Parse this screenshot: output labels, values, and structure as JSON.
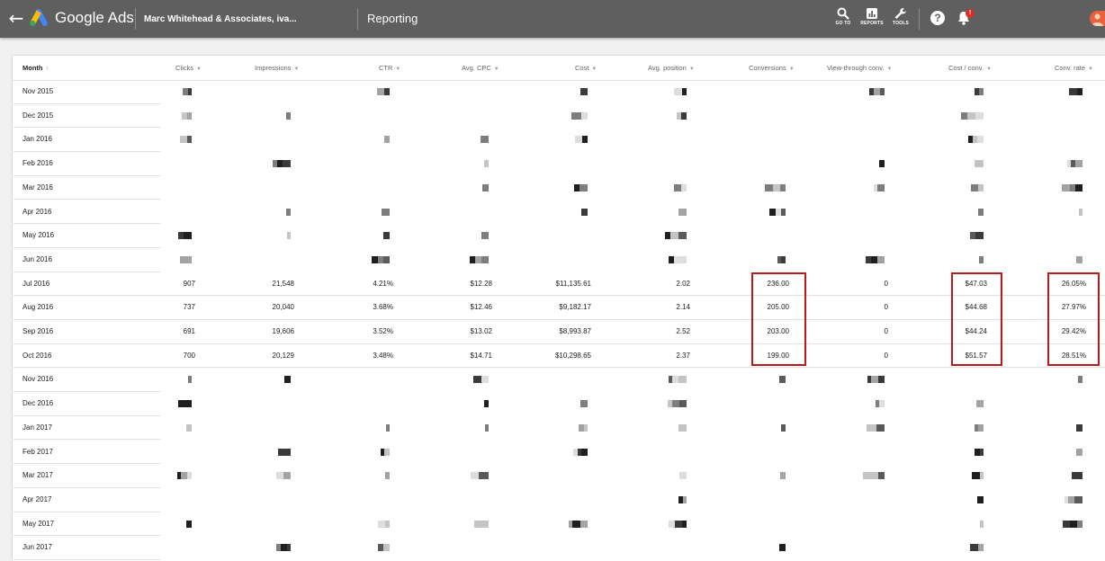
{
  "header": {
    "back_icon": "back-arrow-icon",
    "brand": "Google Ads",
    "account": "Marc Whitehead & Associates, iva...",
    "section": "Reporting",
    "tools": [
      {
        "label": "GO TO",
        "icon": "search-icon"
      },
      {
        "label": "REPORTS",
        "icon": "reports-icon"
      },
      {
        "label": "TOOLS",
        "icon": "wrench-icon"
      }
    ],
    "help_icon": "help-icon",
    "notifications_icon": "bell-icon",
    "notification_badge": "!",
    "colors": {
      "bar": "#5f5f5f",
      "highlight": "#b71c1c",
      "avatar": "#e8633c"
    }
  },
  "table": {
    "columns": [
      {
        "key": "month",
        "label": "Month"
      },
      {
        "key": "clicks",
        "label": "Clicks"
      },
      {
        "key": "impressions",
        "label": "Impressions"
      },
      {
        "key": "ctr",
        "label": "CTR"
      },
      {
        "key": "avg_cpc",
        "label": "Avg. CPC"
      },
      {
        "key": "cost",
        "label": "Cost"
      },
      {
        "key": "avg_position",
        "label": "Avg. position"
      },
      {
        "key": "conversions",
        "label": "Conversions"
      },
      {
        "key": "view_through",
        "label": "View-through conv."
      },
      {
        "key": "cost_conv",
        "label": "Cost / conv."
      },
      {
        "key": "conv_rate",
        "label": "Conv. rate"
      }
    ],
    "sort_column": "month",
    "rows": [
      {
        "month": "Nov 2015",
        "redacted": true
      },
      {
        "month": "Dec 2015",
        "redacted": true
      },
      {
        "month": "Jan 2016",
        "redacted": true
      },
      {
        "month": "Feb 2016",
        "redacted": true
      },
      {
        "month": "Mar 2016",
        "redacted": true
      },
      {
        "month": "Apr 2016",
        "redacted": true
      },
      {
        "month": "May 2016",
        "redacted": true
      },
      {
        "month": "Jun 2016",
        "redacted": true
      },
      {
        "month": "Jul 2016",
        "redacted": false,
        "clicks": "907",
        "impressions": "21,548",
        "ctr": "4.21%",
        "avg_cpc": "$12.28",
        "cost": "$11,135.61",
        "avg_position": "2.02",
        "conversions": "236.00",
        "view_through": "0",
        "cost_conv": "$47.03",
        "conv_rate": "26.05%"
      },
      {
        "month": "Aug 2016",
        "redacted": false,
        "clicks": "737",
        "impressions": "20,040",
        "ctr": "3.68%",
        "avg_cpc": "$12.46",
        "cost": "$9,182.17",
        "avg_position": "2.14",
        "conversions": "205.00",
        "view_through": "0",
        "cost_conv": "$44.68",
        "conv_rate": "27.97%"
      },
      {
        "month": "Sep 2016",
        "redacted": false,
        "clicks": "691",
        "impressions": "19,606",
        "ctr": "3.52%",
        "avg_cpc": "$13.02",
        "cost": "$8,993.87",
        "avg_position": "2.52",
        "conversions": "203.00",
        "view_through": "0",
        "cost_conv": "$44.24",
        "conv_rate": "29.42%"
      },
      {
        "month": "Oct 2016",
        "redacted": false,
        "clicks": "700",
        "impressions": "20,129",
        "ctr": "3.48%",
        "avg_cpc": "$14.71",
        "cost": "$10,298.65",
        "avg_position": "2.37",
        "conversions": "199.00",
        "view_through": "0",
        "cost_conv": "$51.57",
        "conv_rate": "28.51%"
      },
      {
        "month": "Nov 2016",
        "redacted": true
      },
      {
        "month": "Dec 2016",
        "redacted": true
      },
      {
        "month": "Jan 2017",
        "redacted": true
      },
      {
        "month": "Feb 2017",
        "redacted": true
      },
      {
        "month": "Mar 2017",
        "redacted": true
      },
      {
        "month": "Apr 2017",
        "redacted": true
      },
      {
        "month": "May 2017",
        "redacted": true
      },
      {
        "month": "Jun 2017",
        "redacted": true
      }
    ],
    "highlighted_columns": [
      "conversions",
      "cost_conv",
      "conv_rate"
    ]
  }
}
